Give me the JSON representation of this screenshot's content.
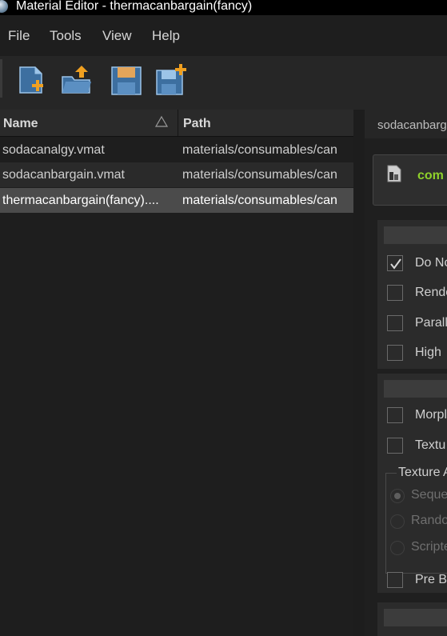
{
  "window": {
    "title": "Material Editor - thermacanbargain(fancy)"
  },
  "menu": [
    "File",
    "Tools",
    "View",
    "Help"
  ],
  "toolbar": {
    "buttons": [
      {
        "icon": "new-file-icon",
        "name": "new-material-button"
      },
      {
        "icon": "open-folder-icon",
        "name": "open-material-button"
      },
      {
        "icon": "save-icon",
        "name": "save-button"
      },
      {
        "icon": "save-as-icon",
        "name": "save-as-button"
      }
    ]
  },
  "file_list": {
    "columns": [
      "Name",
      "Path"
    ],
    "sort": "ascending",
    "rows": [
      {
        "name": "sodacanalgy.vmat",
        "path": "materials/consumables/can"
      },
      {
        "name": "sodacanbargain.vmat",
        "path": "materials/consumables/can"
      },
      {
        "name": "thermacanbargain(fancy)....",
        "path": "materials/consumables/can"
      }
    ],
    "selected_index": 2
  },
  "editor": {
    "tab_label": "sodacanbarg",
    "shader_label": "com",
    "shader_color": "#8fd12b",
    "group1": {
      "checkboxes": [
        {
          "label": "Do No",
          "checked": true
        },
        {
          "label": "Rende",
          "checked": false
        },
        {
          "label": "Parall",
          "checked": false
        },
        {
          "label": "High",
          "checked": false
        }
      ]
    },
    "group2": {
      "checkboxes": [
        {
          "label": "Morpl",
          "checked": false
        },
        {
          "label": "Textu",
          "checked": false
        }
      ],
      "fieldset_legend": "Texture A",
      "radios": [
        {
          "label": "Seque",
          "selected": true
        },
        {
          "label": "Rando",
          "selected": false
        },
        {
          "label": "Scripte",
          "selected": false
        }
      ],
      "extra_checkbox": {
        "label": "Pre B",
        "checked": false
      }
    }
  }
}
